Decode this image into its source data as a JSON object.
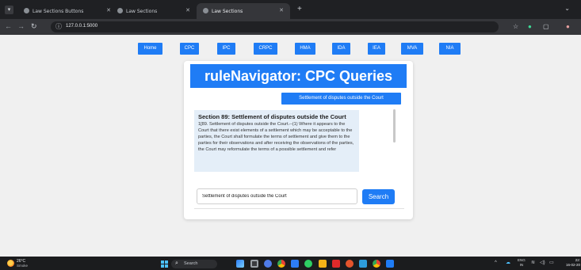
{
  "browser": {
    "tabs": [
      {
        "label": "Law Sections Buttons",
        "active": false
      },
      {
        "label": "Law Sections",
        "active": false
      },
      {
        "label": "Law Sections",
        "active": true
      }
    ],
    "new_tab_icon": "plus-icon",
    "url": "127.0.0.1:5000",
    "url_icon": "info-icon",
    "accent": "#1f7cf5"
  },
  "nav": {
    "items": [
      {
        "label": "Home"
      },
      {
        "label": "CPC"
      },
      {
        "label": "IPC"
      },
      {
        "label": "CRPC"
      },
      {
        "label": "HMA"
      },
      {
        "label": "IDA"
      },
      {
        "label": "IEA"
      },
      {
        "label": "MVA"
      },
      {
        "label": "NIA"
      }
    ]
  },
  "main": {
    "title": "ruleNavigator: CPC Queries",
    "query_chip": "Settlement of disputes outside the Court",
    "result": {
      "title": "Section 89: Settlement of disputes outside the Court",
      "body": "1[89. Settlement of disputes outside the Court.--(1) Where it appears to the Court that there exist elements of a settlement which may be acceptable to the parties, the Court shall formulate the terms of settlement and give them to the parties for their observations and after receiving the observations of the parties, the Court may reformulate the terms of a possible settlement and refer"
    },
    "search": {
      "value": "Settlement of disputes outside the Court",
      "button_label": "Search"
    }
  },
  "taskbar": {
    "weather_temp": "26°C",
    "weather_desc": "Smoke",
    "search_label": "Search",
    "lang_top": "ENG",
    "lang_bottom": "IN",
    "time": "22:",
    "date": "16-02-20"
  }
}
